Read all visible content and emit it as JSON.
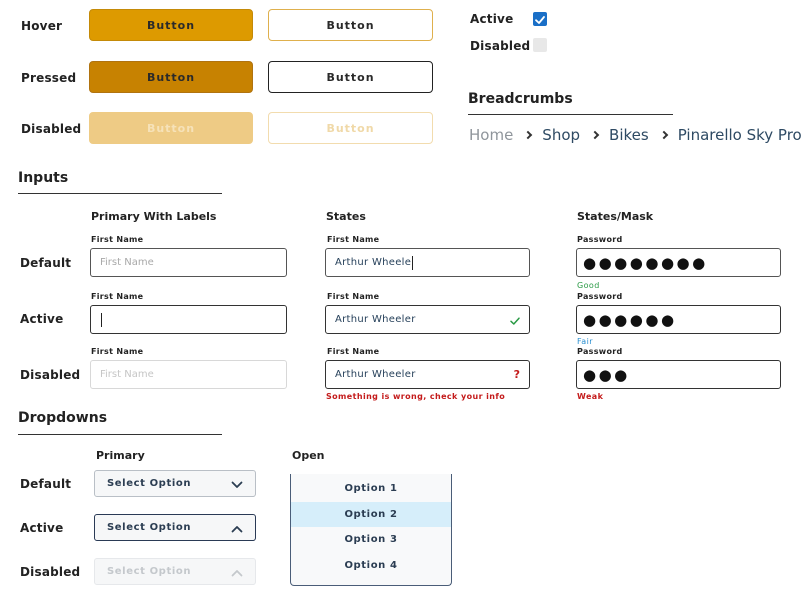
{
  "buttons": {
    "rows": [
      {
        "label": "Hover",
        "primary": "Button",
        "outline": "Button"
      },
      {
        "label": "Pressed",
        "primary": "Button",
        "outline": "Button"
      },
      {
        "label": "Disabled",
        "primary": "Button",
        "outline": "Button"
      }
    ]
  },
  "checkboxes": {
    "active_label": "Active",
    "disabled_label": "Disabled",
    "active_checked": true,
    "disabled_checked": false
  },
  "breadcrumbs": {
    "title": "Breadcrumbs",
    "items": [
      "Home",
      "Shop",
      "Bikes",
      "Pinarello Sky Pro"
    ]
  },
  "inputs": {
    "title": "Inputs",
    "columns": [
      "Primary With Labels",
      "States",
      "States/Mask"
    ],
    "rows": [
      "Default",
      "Active",
      "Disabled"
    ],
    "primary": {
      "label": "First Name",
      "default_placeholder": "First Name",
      "disabled_placeholder": "First Name"
    },
    "states": {
      "label": "First Name",
      "default_value": "Arthur Wheele",
      "active_value": "Arthur Wheeler",
      "error_value": "Arthur Wheeler",
      "error_message": "Something is wrong, check your info",
      "error_icon": "?"
    },
    "mask": {
      "label": "Password",
      "default_mask": "●●●●●●●●",
      "default_hint": "Good",
      "active_mask": "●●●●●●",
      "active_hint": "Fair",
      "disabled_mask": "●●●",
      "disabled_hint": "Weak"
    }
  },
  "dropdowns": {
    "title": "Dropdowns",
    "primary_head": "Primary",
    "open_head": "Open",
    "rows": [
      "Default",
      "Active",
      "Disabled"
    ],
    "select_label": "Select Option",
    "options": [
      "Option 1",
      "Option 2",
      "Option 3",
      "Option 4"
    ],
    "selected_index": 1
  },
  "colors": {
    "primary": "#dd9a00",
    "primary_pressed": "#c78201",
    "primary_disabled": "#eecb85",
    "checkbox_active": "#1a6fc7",
    "good": "#2a9a45",
    "fair": "#2a8fd0",
    "error": "#c41b1b",
    "option_selected": "#d6eefa"
  }
}
